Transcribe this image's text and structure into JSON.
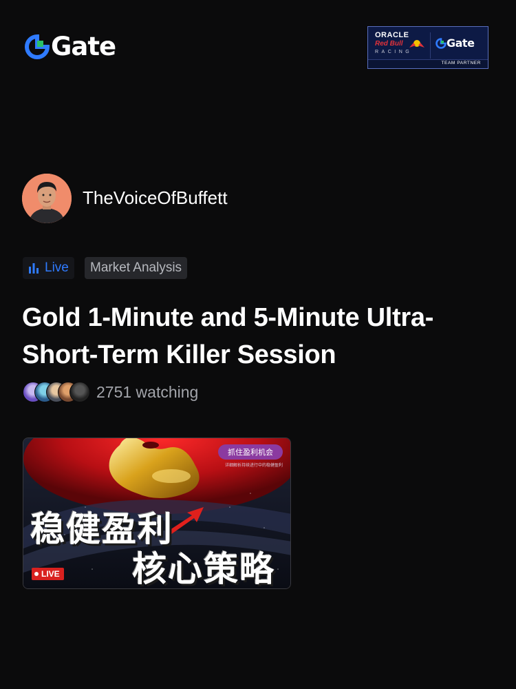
{
  "brand": {
    "name": "Gate",
    "accent": "#2f7bff",
    "mark_green": "#2ac06a"
  },
  "partner_badge": {
    "oracle": "ORACLE",
    "redbull": "Red Bull",
    "racing": "RACING",
    "gate": "Gate",
    "footer": "TEAM PARTNER"
  },
  "streamer": {
    "username": "TheVoiceOfBuffett",
    "avatar_icon": "person-avatar"
  },
  "tags": {
    "live_label": "Live",
    "live_icon": "bar-chart-icon",
    "category": "Market Analysis"
  },
  "stream": {
    "title": "Gold 1-Minute and 5-Minute Ultra-Short-Term Killer Session",
    "watching": "2751 watching"
  },
  "thumbnail": {
    "pill": "抓住盈利机会",
    "subtitle": "详细解析持续进行中的稳健盈利",
    "line1": "稳健盈利",
    "line2": "核心策略",
    "live_badge": "LIVE"
  }
}
